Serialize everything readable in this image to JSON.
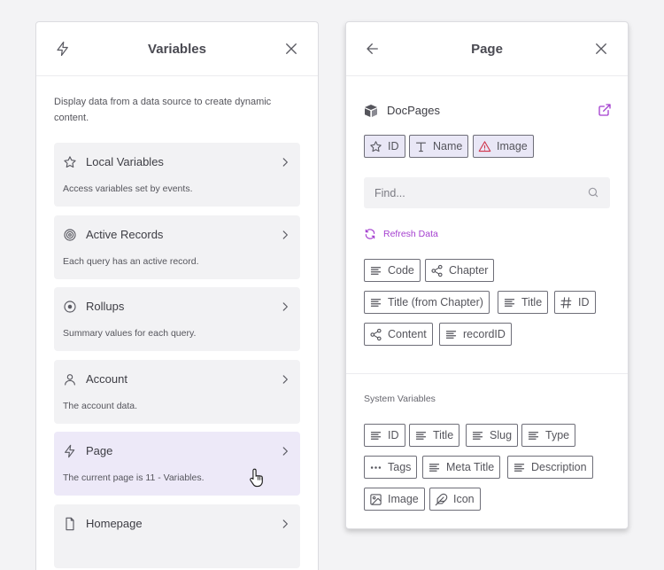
{
  "left_panel": {
    "title": "Variables",
    "intro": "Display data from a data source to create dynamic content.",
    "cards": [
      {
        "title": "Local Variables",
        "desc": "Access variables set by events.",
        "icon": "star-icon"
      },
      {
        "title": "Active Records",
        "desc": "Each query has an active record.",
        "icon": "target-icon"
      },
      {
        "title": "Rollups",
        "desc": "Summary values for each query.",
        "icon": "circle-dot-icon"
      },
      {
        "title": "Account",
        "desc": "The account data.",
        "icon": "user-icon"
      },
      {
        "title": "Page",
        "desc": "The current page is 11 - Variables.",
        "icon": "bolt-icon",
        "active": true
      },
      {
        "title": "Homepage",
        "desc": "",
        "icon": "file-icon"
      }
    ]
  },
  "right_panel": {
    "title": "Page",
    "source_name": "DocPages",
    "source_chips": [
      {
        "label": "ID",
        "icon": "star-icon"
      },
      {
        "label": "Name",
        "icon": "text-icon"
      },
      {
        "label": "Image",
        "icon": "warning-icon"
      }
    ],
    "find_placeholder": "Find...",
    "refresh_label": "Refresh Data",
    "field_chips": [
      {
        "label": "Code",
        "icon": "lines-icon"
      },
      {
        "label": "Chapter",
        "icon": "share-icon"
      },
      {
        "label": "Title (from Chapter)",
        "icon": "lines-icon"
      },
      {
        "label": "Title",
        "icon": "lines-icon"
      },
      {
        "label": "ID",
        "icon": "hash-icon"
      },
      {
        "label": "Content",
        "icon": "share-icon"
      },
      {
        "label": "recordID",
        "icon": "lines-icon"
      }
    ],
    "system_label": "System Variables",
    "system_chips": [
      {
        "label": "ID",
        "icon": "lines-icon"
      },
      {
        "label": "Title",
        "icon": "lines-icon"
      },
      {
        "label": "Slug",
        "icon": "lines-icon"
      },
      {
        "label": "Type",
        "icon": "lines-icon"
      },
      {
        "label": "Tags",
        "icon": "dots-icon"
      },
      {
        "label": "Meta Title",
        "icon": "lines-icon"
      },
      {
        "label": "Description",
        "icon": "lines-icon"
      },
      {
        "label": "Image",
        "icon": "image-icon"
      },
      {
        "label": "Icon",
        "icon": "feather-icon"
      }
    ]
  },
  "colors": {
    "accent": "#a43fcf",
    "warning": "#d0344a",
    "active_card": "#ede9f8"
  }
}
